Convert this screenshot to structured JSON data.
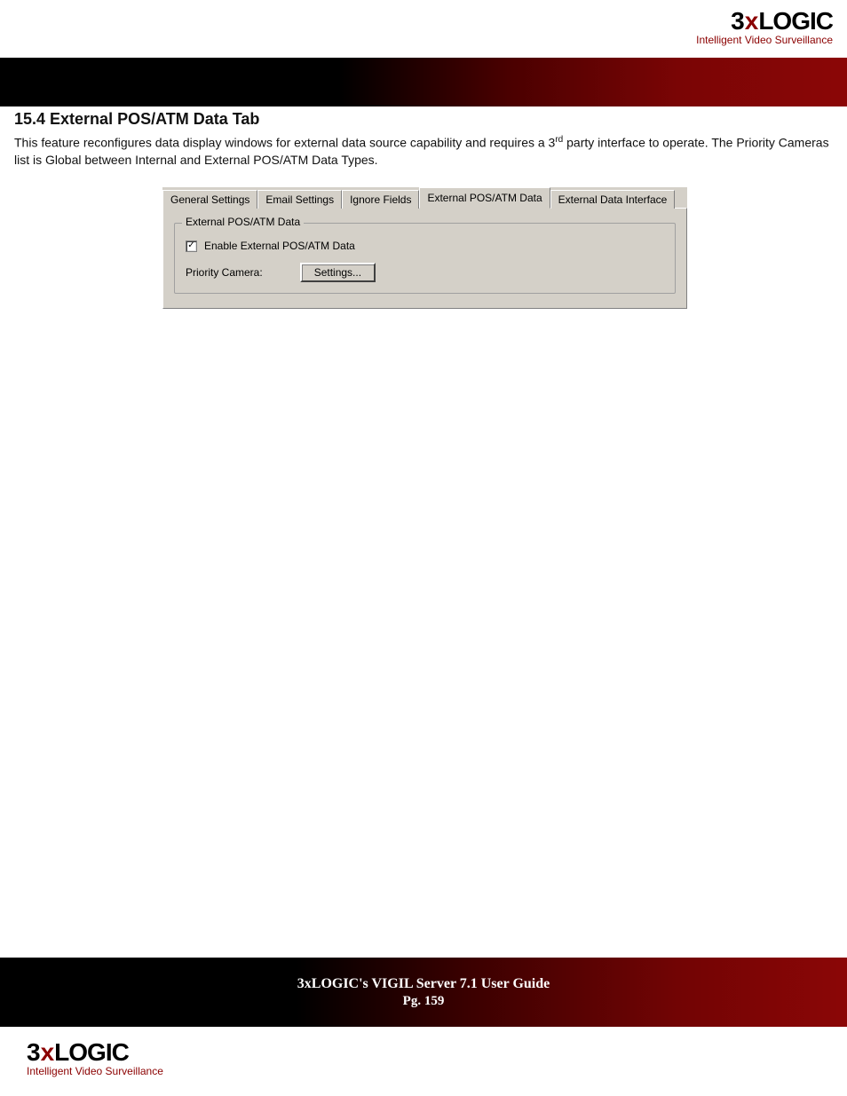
{
  "brand": {
    "name_pre": "3",
    "name_x": "x",
    "name_post": "LOGIC",
    "tagline": "Intelligent Video Surveillance"
  },
  "section": {
    "title": "15.4 External POS/ATM Data Tab",
    "body_1": "This feature reconfigures data display windows for external data source capability and requires a 3",
    "body_sup": "rd",
    "body_2": " party interface to operate. The Priority Cameras list is Global between Internal and External POS/ATM Data Types."
  },
  "dialog": {
    "tabs": {
      "general": "General Settings",
      "email": "Email Settings",
      "ignore": "Ignore Fields",
      "external_pos": "External POS/ATM Data",
      "external_data": "External Data Interface"
    },
    "group_title": "External POS/ATM Data",
    "checkbox_label": "Enable External POS/ATM Data",
    "checkbox_mark": "✓",
    "priority_label": "Priority Camera:",
    "settings_button": "Settings..."
  },
  "footer": {
    "title": "3xLOGIC's VIGIL Server 7.1 User Guide",
    "page": "Pg. 159"
  }
}
